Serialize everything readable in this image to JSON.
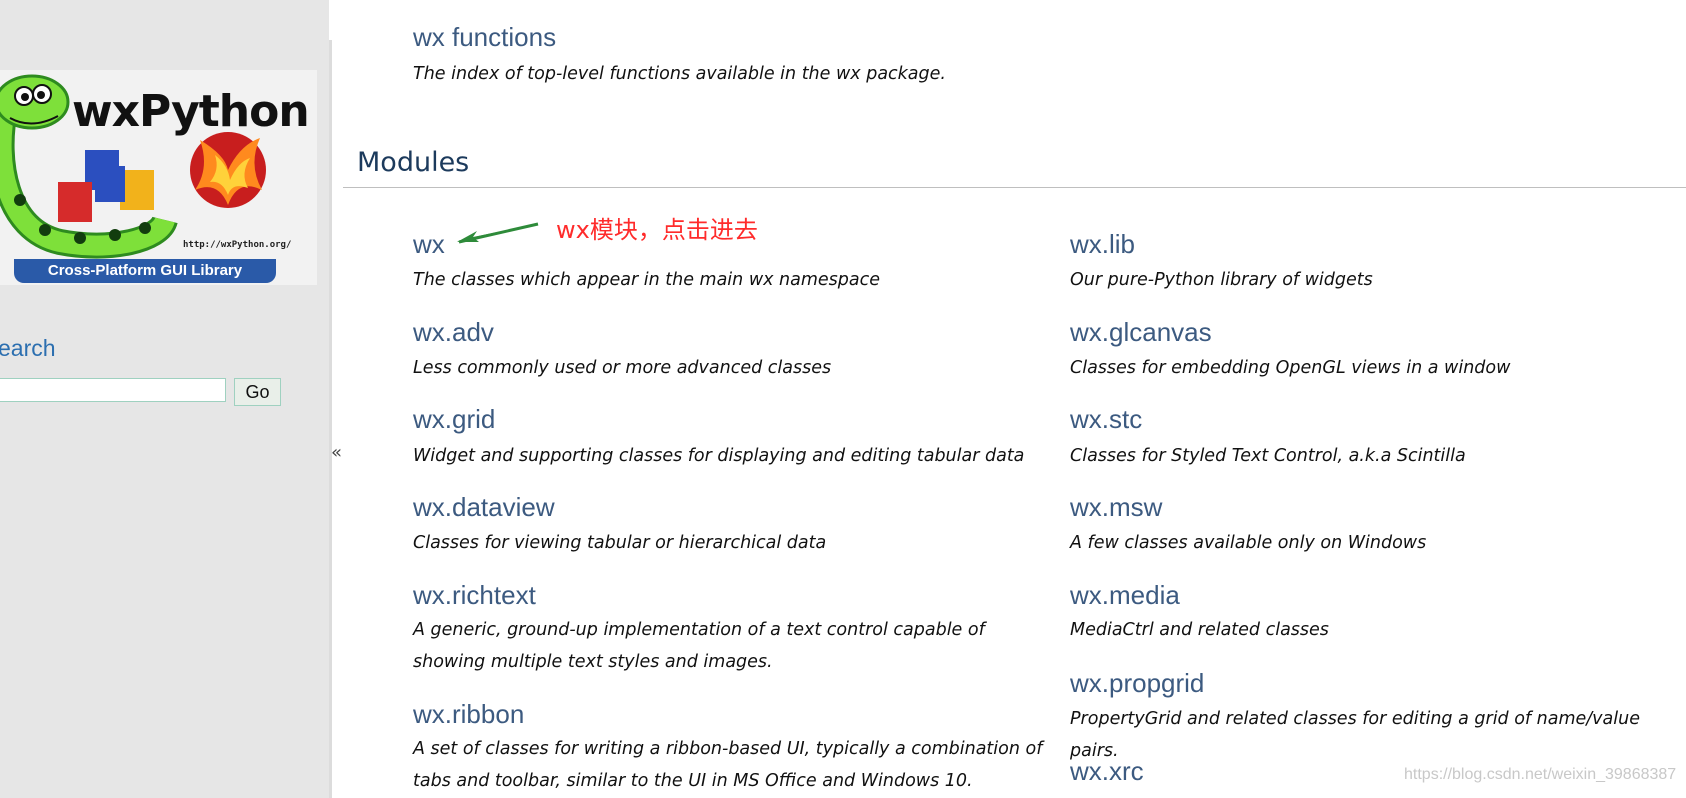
{
  "sidebar": {
    "logo": {
      "title": "wxPython",
      "url": "http://wxPython.org/",
      "tagline": "Cross-Platform GUI Library"
    },
    "search": {
      "label": "earch",
      "value": "",
      "button": "Go"
    },
    "collapse": "«"
  },
  "main": {
    "functions": {
      "title": "wx functions",
      "desc": "The index of top-level functions available in the wx package."
    },
    "section_title": "Modules",
    "annotation": "wx模块，点击进去",
    "left": [
      {
        "title": "wx",
        "desc": "The classes which appear in the main wx namespace"
      },
      {
        "title": "wx.adv",
        "desc": "Less commonly used or more advanced classes"
      },
      {
        "title": "wx.grid",
        "desc": "Widget and supporting classes for displaying and editing tabular data"
      },
      {
        "title": "wx.dataview",
        "desc": "Classes for viewing tabular or hierarchical data"
      },
      {
        "title": "wx.richtext",
        "desc": "A generic, ground-up implementation of a text control capable of showing multiple text styles and images."
      },
      {
        "title": "wx.ribbon",
        "desc": "A set of classes for writing a ribbon-based UI, typically a combination of tabs and toolbar, similar to the UI in MS Office and Windows 10."
      }
    ],
    "right": [
      {
        "title": "wx.lib",
        "desc": "Our pure-Python library of widgets"
      },
      {
        "title": "wx.glcanvas",
        "desc": "Classes for embedding OpenGL views in a window"
      },
      {
        "title": "wx.stc",
        "desc": "Classes for Styled Text Control, a.k.a Scintilla"
      },
      {
        "title": "wx.msw",
        "desc": "A few classes available only on Windows"
      },
      {
        "title": "wx.media",
        "desc": "MediaCtrl and related classes"
      },
      {
        "title": "wx.propgrid",
        "desc": "PropertyGrid and related classes for editing a grid of name/value pairs."
      },
      {
        "title": "wx.xrc",
        "desc": ""
      }
    ],
    "watermark": "https://blog.csdn.net/weixin_39868387"
  },
  "colors": {
    "link": "#3c5a80",
    "annotation": "#ff2b2b",
    "sidebar_bg": "#e6e6e6"
  }
}
